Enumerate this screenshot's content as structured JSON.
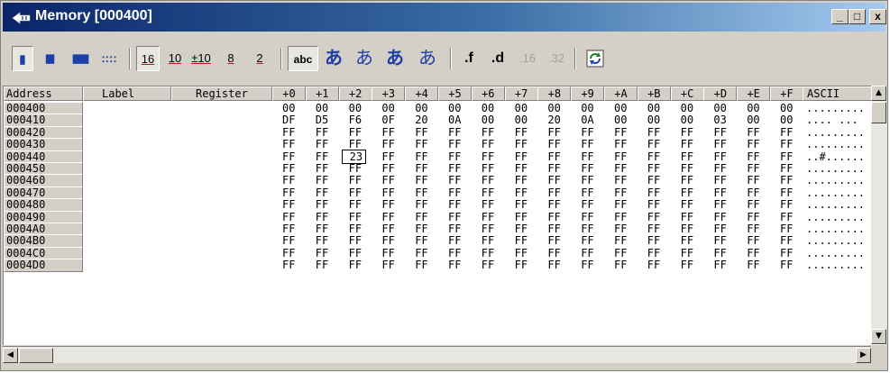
{
  "window": {
    "title": "Memory [000400]",
    "minimize": "_",
    "maximize": "□",
    "close": "x"
  },
  "toolbar": {
    "column_buttons": [
      "▮",
      "▮▮",
      "▮▮▮▮",
      "::::"
    ],
    "radix_buttons": [
      "16",
      "10",
      "±10",
      "8",
      "2"
    ],
    "text_buttons": [
      "abc",
      "あ",
      "あ",
      "あ",
      "あ"
    ],
    "float_buttons": [
      ".f",
      ".d",
      ".16",
      ".32"
    ],
    "refresh_icon": "refresh-icon"
  },
  "table": {
    "headers": {
      "address": "Address",
      "label": "Label",
      "register": "Register",
      "ascii": "ASCII"
    },
    "offsets": [
      "+0",
      "+1",
      "+2",
      "+3",
      "+4",
      "+5",
      "+6",
      "+7",
      "+8",
      "+9",
      "+A",
      "+B",
      "+C",
      "+D",
      "+E",
      "+F"
    ],
    "rows": [
      {
        "address": "000400",
        "bytes": [
          "00",
          "00",
          "00",
          "00",
          "00",
          "00",
          "00",
          "00",
          "00",
          "00",
          "00",
          "00",
          "00",
          "00",
          "00",
          "00"
        ],
        "ascii": "........."
      },
      {
        "address": "000410",
        "bytes": [
          "DF",
          "D5",
          "F6",
          "0F",
          "20",
          "0A",
          "00",
          "00",
          "20",
          "0A",
          "00",
          "00",
          "00",
          "03",
          "00",
          "00"
        ],
        "ascii": ".... ..."
      },
      {
        "address": "000420",
        "bytes": [
          "FF",
          "FF",
          "FF",
          "FF",
          "FF",
          "FF",
          "FF",
          "FF",
          "FF",
          "FF",
          "FF",
          "FF",
          "FF",
          "FF",
          "FF",
          "FF"
        ],
        "ascii": "........."
      },
      {
        "address": "000430",
        "bytes": [
          "FF",
          "FF",
          "FF",
          "FF",
          "FF",
          "FF",
          "FF",
          "FF",
          "FF",
          "FF",
          "FF",
          "FF",
          "FF",
          "FF",
          "FF",
          "FF"
        ],
        "ascii": "........."
      },
      {
        "address": "000440",
        "bytes": [
          "FF",
          "FF",
          "23",
          "FF",
          "FF",
          "FF",
          "FF",
          "FF",
          "FF",
          "FF",
          "FF",
          "FF",
          "FF",
          "FF",
          "FF",
          "FF"
        ],
        "ascii": "..#......"
      },
      {
        "address": "000450",
        "bytes": [
          "FF",
          "FF",
          "FF",
          "FF",
          "FF",
          "FF",
          "FF",
          "FF",
          "FF",
          "FF",
          "FF",
          "FF",
          "FF",
          "FF",
          "FF",
          "FF"
        ],
        "ascii": "........."
      },
      {
        "address": "000460",
        "bytes": [
          "FF",
          "FF",
          "FF",
          "FF",
          "FF",
          "FF",
          "FF",
          "FF",
          "FF",
          "FF",
          "FF",
          "FF",
          "FF",
          "FF",
          "FF",
          "FF"
        ],
        "ascii": "........."
      },
      {
        "address": "000470",
        "bytes": [
          "FF",
          "FF",
          "FF",
          "FF",
          "FF",
          "FF",
          "FF",
          "FF",
          "FF",
          "FF",
          "FF",
          "FF",
          "FF",
          "FF",
          "FF",
          "FF"
        ],
        "ascii": "........."
      },
      {
        "address": "000480",
        "bytes": [
          "FF",
          "FF",
          "FF",
          "FF",
          "FF",
          "FF",
          "FF",
          "FF",
          "FF",
          "FF",
          "FF",
          "FF",
          "FF",
          "FF",
          "FF",
          "FF"
        ],
        "ascii": "........."
      },
      {
        "address": "000490",
        "bytes": [
          "FF",
          "FF",
          "FF",
          "FF",
          "FF",
          "FF",
          "FF",
          "FF",
          "FF",
          "FF",
          "FF",
          "FF",
          "FF",
          "FF",
          "FF",
          "FF"
        ],
        "ascii": "........."
      },
      {
        "address": "0004A0",
        "bytes": [
          "FF",
          "FF",
          "FF",
          "FF",
          "FF",
          "FF",
          "FF",
          "FF",
          "FF",
          "FF",
          "FF",
          "FF",
          "FF",
          "FF",
          "FF",
          "FF"
        ],
        "ascii": "........."
      },
      {
        "address": "0004B0",
        "bytes": [
          "FF",
          "FF",
          "FF",
          "FF",
          "FF",
          "FF",
          "FF",
          "FF",
          "FF",
          "FF",
          "FF",
          "FF",
          "FF",
          "FF",
          "FF",
          "FF"
        ],
        "ascii": "........."
      },
      {
        "address": "0004C0",
        "bytes": [
          "FF",
          "FF",
          "FF",
          "FF",
          "FF",
          "FF",
          "FF",
          "FF",
          "FF",
          "FF",
          "FF",
          "FF",
          "FF",
          "FF",
          "FF",
          "FF"
        ],
        "ascii": "........."
      },
      {
        "address": "0004D0",
        "bytes": [
          "FF",
          "FF",
          "FF",
          "FF",
          "FF",
          "FF",
          "FF",
          "FF",
          "FF",
          "FF",
          "FF",
          "FF",
          "FF",
          "FF",
          "FF",
          "FF"
        ],
        "ascii": "........."
      }
    ],
    "selected_cell": {
      "row": 4,
      "col": 2
    }
  },
  "colors": {
    "title_start": "#0a246a",
    "title_end": "#a6caf0",
    "face": "#d4d0c8",
    "text_blue": "#1f3fa8",
    "text_red": "#d01010"
  }
}
